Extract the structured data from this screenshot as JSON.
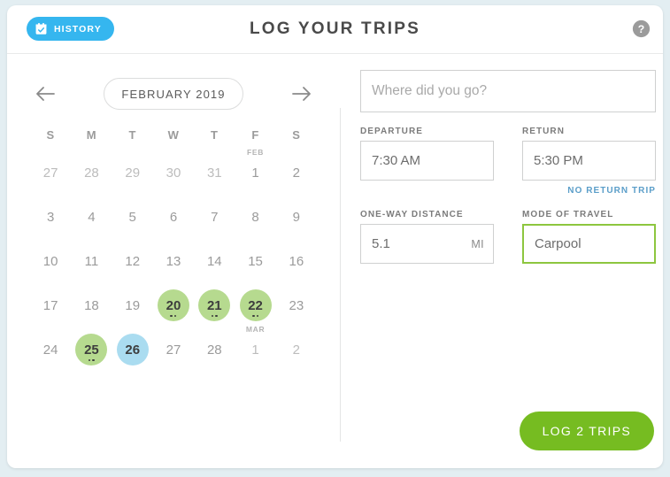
{
  "header": {
    "history_label": "HISTORY",
    "history_icon": "calendar-check-icon",
    "title": "LOG YOUR TRIPS",
    "help_icon": "help-circle-icon",
    "history_bg": "#35b6ef"
  },
  "calendar": {
    "prev_icon": "arrow-left-icon",
    "next_icon": "arrow-right-icon",
    "month_label": "FEBRUARY 2019",
    "weekdays": [
      "S",
      "M",
      "T",
      "W",
      "T",
      "F",
      "S"
    ],
    "logged_color": "#b6da8f",
    "selected_color": "#aadcf0",
    "weeks": [
      [
        {
          "day": "27",
          "state": "muted"
        },
        {
          "day": "28",
          "state": "muted"
        },
        {
          "day": "29",
          "state": "muted"
        },
        {
          "day": "30",
          "state": "muted"
        },
        {
          "day": "31",
          "state": "muted"
        },
        {
          "day": "1",
          "state": "normal",
          "tag": "FEB"
        },
        {
          "day": "2",
          "state": "normal"
        }
      ],
      [
        {
          "day": "3",
          "state": "normal"
        },
        {
          "day": "4",
          "state": "normal"
        },
        {
          "day": "5",
          "state": "normal"
        },
        {
          "day": "6",
          "state": "normal"
        },
        {
          "day": "7",
          "state": "normal"
        },
        {
          "day": "8",
          "state": "normal"
        },
        {
          "day": "9",
          "state": "normal"
        }
      ],
      [
        {
          "day": "10",
          "state": "normal"
        },
        {
          "day": "11",
          "state": "normal"
        },
        {
          "day": "12",
          "state": "normal"
        },
        {
          "day": "13",
          "state": "normal"
        },
        {
          "day": "14",
          "state": "normal"
        },
        {
          "day": "15",
          "state": "normal"
        },
        {
          "day": "16",
          "state": "normal"
        }
      ],
      [
        {
          "day": "17",
          "state": "normal"
        },
        {
          "day": "18",
          "state": "normal"
        },
        {
          "day": "19",
          "state": "normal"
        },
        {
          "day": "20",
          "state": "logged",
          "dots": 2
        },
        {
          "day": "21",
          "state": "logged",
          "dots": 2
        },
        {
          "day": "22",
          "state": "logged",
          "dots": 2
        },
        {
          "day": "23",
          "state": "normal"
        }
      ],
      [
        {
          "day": "24",
          "state": "normal"
        },
        {
          "day": "25",
          "state": "logged",
          "dots": 2
        },
        {
          "day": "26",
          "state": "selected"
        },
        {
          "day": "27",
          "state": "normal"
        },
        {
          "day": "28",
          "state": "normal"
        },
        {
          "day": "1",
          "state": "muted",
          "tag": "MAR"
        },
        {
          "day": "2",
          "state": "muted"
        }
      ]
    ]
  },
  "form": {
    "destination": {
      "value": "",
      "placeholder": "Where did you go?"
    },
    "departure": {
      "label": "DEPARTURE",
      "value": "7:30 AM"
    },
    "return": {
      "label": "RETURN",
      "value": "5:30 PM",
      "no_return_link": "NO RETURN TRIP",
      "link_color": "#5b9ec9"
    },
    "distance": {
      "label": "ONE-WAY DISTANCE",
      "value": "5.1",
      "unit": "MI"
    },
    "mode": {
      "label": "MODE OF TRAVEL",
      "value": "Carpool",
      "focus_color": "#8dc63f"
    }
  },
  "footer": {
    "log_button": "LOG 2 TRIPS",
    "log_button_color": "#76bc21"
  }
}
